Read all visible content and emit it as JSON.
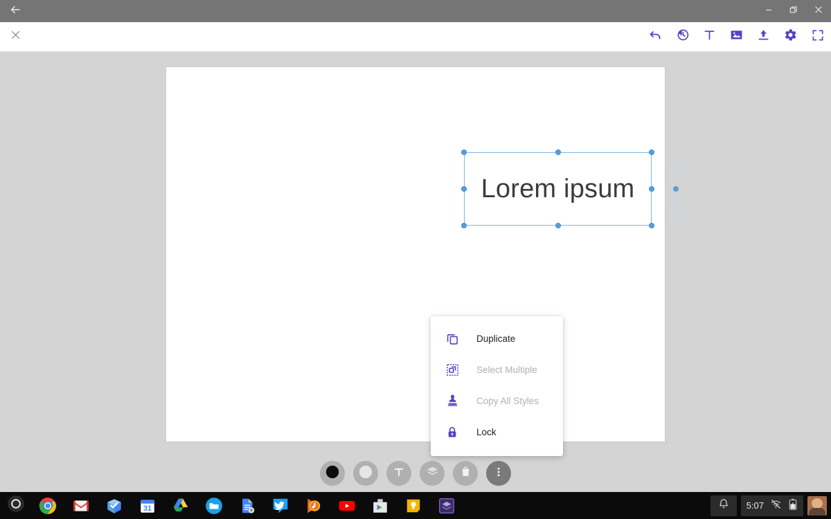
{
  "window": {
    "back_icon": "back-arrow-icon",
    "minimize_label": "–",
    "restore_label": "restore-icon",
    "close_label": "×"
  },
  "appbar": {
    "close_label": "×",
    "tools": [
      {
        "name": "undo-icon",
        "title": "Undo"
      },
      {
        "name": "history-icon",
        "title": "History"
      },
      {
        "name": "text-tool-icon",
        "title": "Text"
      },
      {
        "name": "image-icon",
        "title": "Image"
      },
      {
        "name": "upload-icon",
        "title": "Upload"
      },
      {
        "name": "settings-gear-icon",
        "title": "Settings"
      },
      {
        "name": "fullscreen-icon",
        "title": "Fullscreen"
      }
    ],
    "accent_color": "#5b3fc4"
  },
  "canvas": {
    "background_color": "#ffffff",
    "workspace_color": "#d4d4d4",
    "selected_object": {
      "text": "Lorem ipsum",
      "text_color": "#3c3c3c",
      "selection_color": "#7fb5e3",
      "handle_color": "#53a0de"
    },
    "size_slider": {
      "name": "font-size-slider",
      "ticks": 17,
      "active_tick_index": 8
    }
  },
  "context_menu": {
    "items": [
      {
        "label": "Duplicate",
        "icon": "duplicate-icon",
        "enabled": true
      },
      {
        "label": "Select Multiple",
        "icon": "select-multiple-icon",
        "enabled": false
      },
      {
        "label": "Copy All Styles",
        "icon": "stamp-icon",
        "enabled": false
      },
      {
        "label": "Lock",
        "icon": "lock-icon",
        "enabled": true
      }
    ]
  },
  "bottom_toolbar": {
    "buttons": [
      {
        "name": "color-swatch-button",
        "icon": "black-circle-icon"
      },
      {
        "name": "opacity-button",
        "icon": "checker-circle-icon"
      },
      {
        "name": "text-button",
        "icon": "text-T-icon"
      },
      {
        "name": "layers-button",
        "icon": "layers-icon"
      },
      {
        "name": "delete-button",
        "icon": "trash-icon"
      },
      {
        "name": "more-options-button",
        "icon": "three-dots-vertical-icon"
      }
    ]
  },
  "shelf": {
    "launcher": "launcher-circle-icon",
    "apps": [
      {
        "name": "chrome",
        "label": "Chrome"
      },
      {
        "name": "gmail",
        "label": "Gmail"
      },
      {
        "name": "inbox",
        "label": "Inbox"
      },
      {
        "name": "calendar",
        "label": "31"
      },
      {
        "name": "drive",
        "label": "Drive"
      },
      {
        "name": "files",
        "label": "Files"
      },
      {
        "name": "docs",
        "label": "Docs"
      },
      {
        "name": "twitter",
        "label": "Twitter"
      },
      {
        "name": "play-music",
        "label": "Play Music"
      },
      {
        "name": "youtube",
        "label": "YouTube"
      },
      {
        "name": "play-store",
        "label": "Play Store"
      },
      {
        "name": "keep",
        "label": "Keep"
      },
      {
        "name": "purple-app",
        "label": "App"
      }
    ],
    "tray": {
      "notification_icon": "bell-icon",
      "time": "5:07",
      "network_icon": "wifi-off-icon",
      "battery_icon": "battery-charging-icon",
      "avatar": "user-avatar"
    }
  }
}
